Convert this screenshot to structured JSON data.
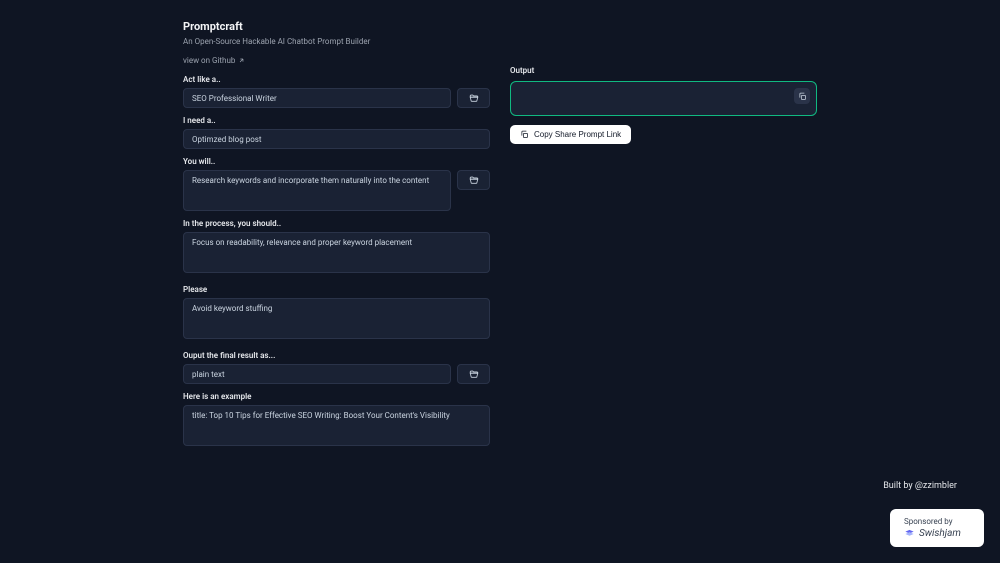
{
  "header": {
    "title": "Promptcraft",
    "subtitle": "An Open-Source Hackable AI Chatbot Prompt Builder",
    "github_link": "view on Github"
  },
  "fields": {
    "act_like": {
      "label": "Act like a..",
      "value": "SEO Professional Writer"
    },
    "need": {
      "label": "I need a..",
      "value": "Optimzed blog post"
    },
    "you_will": {
      "label": "You will..",
      "value": "Research keywords and incorporate them naturally into the content"
    },
    "process": {
      "label": "In the process, you should..",
      "value": "Focus on readability, relevance and proper keyword placement"
    },
    "please": {
      "label": "Please",
      "value": "Avoid keyword stuffing"
    },
    "output_as": {
      "label": "Ouput the final result as...",
      "value": "plain text"
    },
    "example": {
      "label": "Here is an example",
      "value": "title: Top 10 Tips for Effective SEO Writing: Boost Your Content's Visibility"
    }
  },
  "output": {
    "label": "Output",
    "share_button": "Copy Share Prompt Link"
  },
  "footer": {
    "credit_prefix": "Built by ",
    "credit_handle": "@zzimbler",
    "sponsored_by": "Sponsored by",
    "sponsor_name": "Swishjam"
  }
}
